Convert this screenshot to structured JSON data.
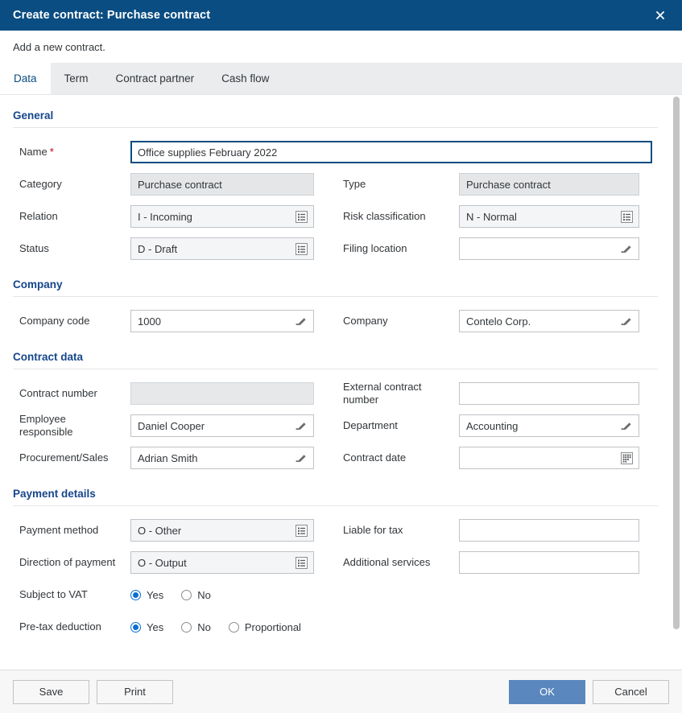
{
  "window": {
    "title": "Create contract: Purchase contract",
    "close_icon": "close-icon",
    "subtitle": "Add a new contract."
  },
  "tabs": [
    {
      "label": "Data",
      "active": true
    },
    {
      "label": "Term",
      "active": false
    },
    {
      "label": "Contract partner",
      "active": false
    },
    {
      "label": "Cash flow",
      "active": false
    }
  ],
  "colors": {
    "titlebar": "#0a4d82",
    "section_heading": "#16468c",
    "primary_button": "#5a87bd",
    "radio_selected": "#0a6ed1",
    "required_star": "#bb0000"
  },
  "sections": {
    "general": {
      "title": "General",
      "name": {
        "label": "Name",
        "required_marker": "*",
        "value": "Office supplies February 2022"
      },
      "category": {
        "label": "Category",
        "value": "Purchase contract"
      },
      "type": {
        "label": "Type",
        "value": "Purchase contract"
      },
      "relation": {
        "label": "Relation",
        "value": "I - Incoming"
      },
      "risk_classification": {
        "label": "Risk classification",
        "value": "N - Normal"
      },
      "status": {
        "label": "Status",
        "value": "D - Draft"
      },
      "filing_location": {
        "label": "Filing location",
        "value": ""
      }
    },
    "company": {
      "title": "Company",
      "company_code": {
        "label": "Company code",
        "value": "1000"
      },
      "company": {
        "label": "Company",
        "value": "Contelo Corp."
      }
    },
    "contract_data": {
      "title": "Contract data",
      "contract_number": {
        "label": "Contract number",
        "value": ""
      },
      "external_contract_number": {
        "label": "External contract number",
        "value": ""
      },
      "employee_responsible": {
        "label": "Employee responsible",
        "value": "Daniel Cooper"
      },
      "department": {
        "label": "Department",
        "value": "Accounting"
      },
      "procurement_sales": {
        "label": "Procurement/Sales",
        "value": "Adrian Smith"
      },
      "contract_date": {
        "label": "Contract date",
        "value": ""
      }
    },
    "payment_details": {
      "title": "Payment details",
      "payment_method": {
        "label": "Payment method",
        "value": "O - Other"
      },
      "liable_for_tax": {
        "label": "Liable for tax",
        "value": ""
      },
      "direction_of_payment": {
        "label": "Direction of payment",
        "value": "O - Output"
      },
      "additional_services": {
        "label": "Additional services",
        "value": ""
      },
      "subject_to_vat": {
        "label": "Subject to VAT",
        "options": [
          {
            "label": "Yes",
            "selected": true
          },
          {
            "label": "No",
            "selected": false
          }
        ]
      },
      "pre_tax_deduction": {
        "label": "Pre-tax deduction",
        "options": [
          {
            "label": "Yes",
            "selected": true
          },
          {
            "label": "No",
            "selected": false
          },
          {
            "label": "Proportional",
            "selected": false
          }
        ]
      }
    }
  },
  "footer": {
    "save": "Save",
    "print": "Print",
    "ok": "OK",
    "cancel": "Cancel"
  }
}
